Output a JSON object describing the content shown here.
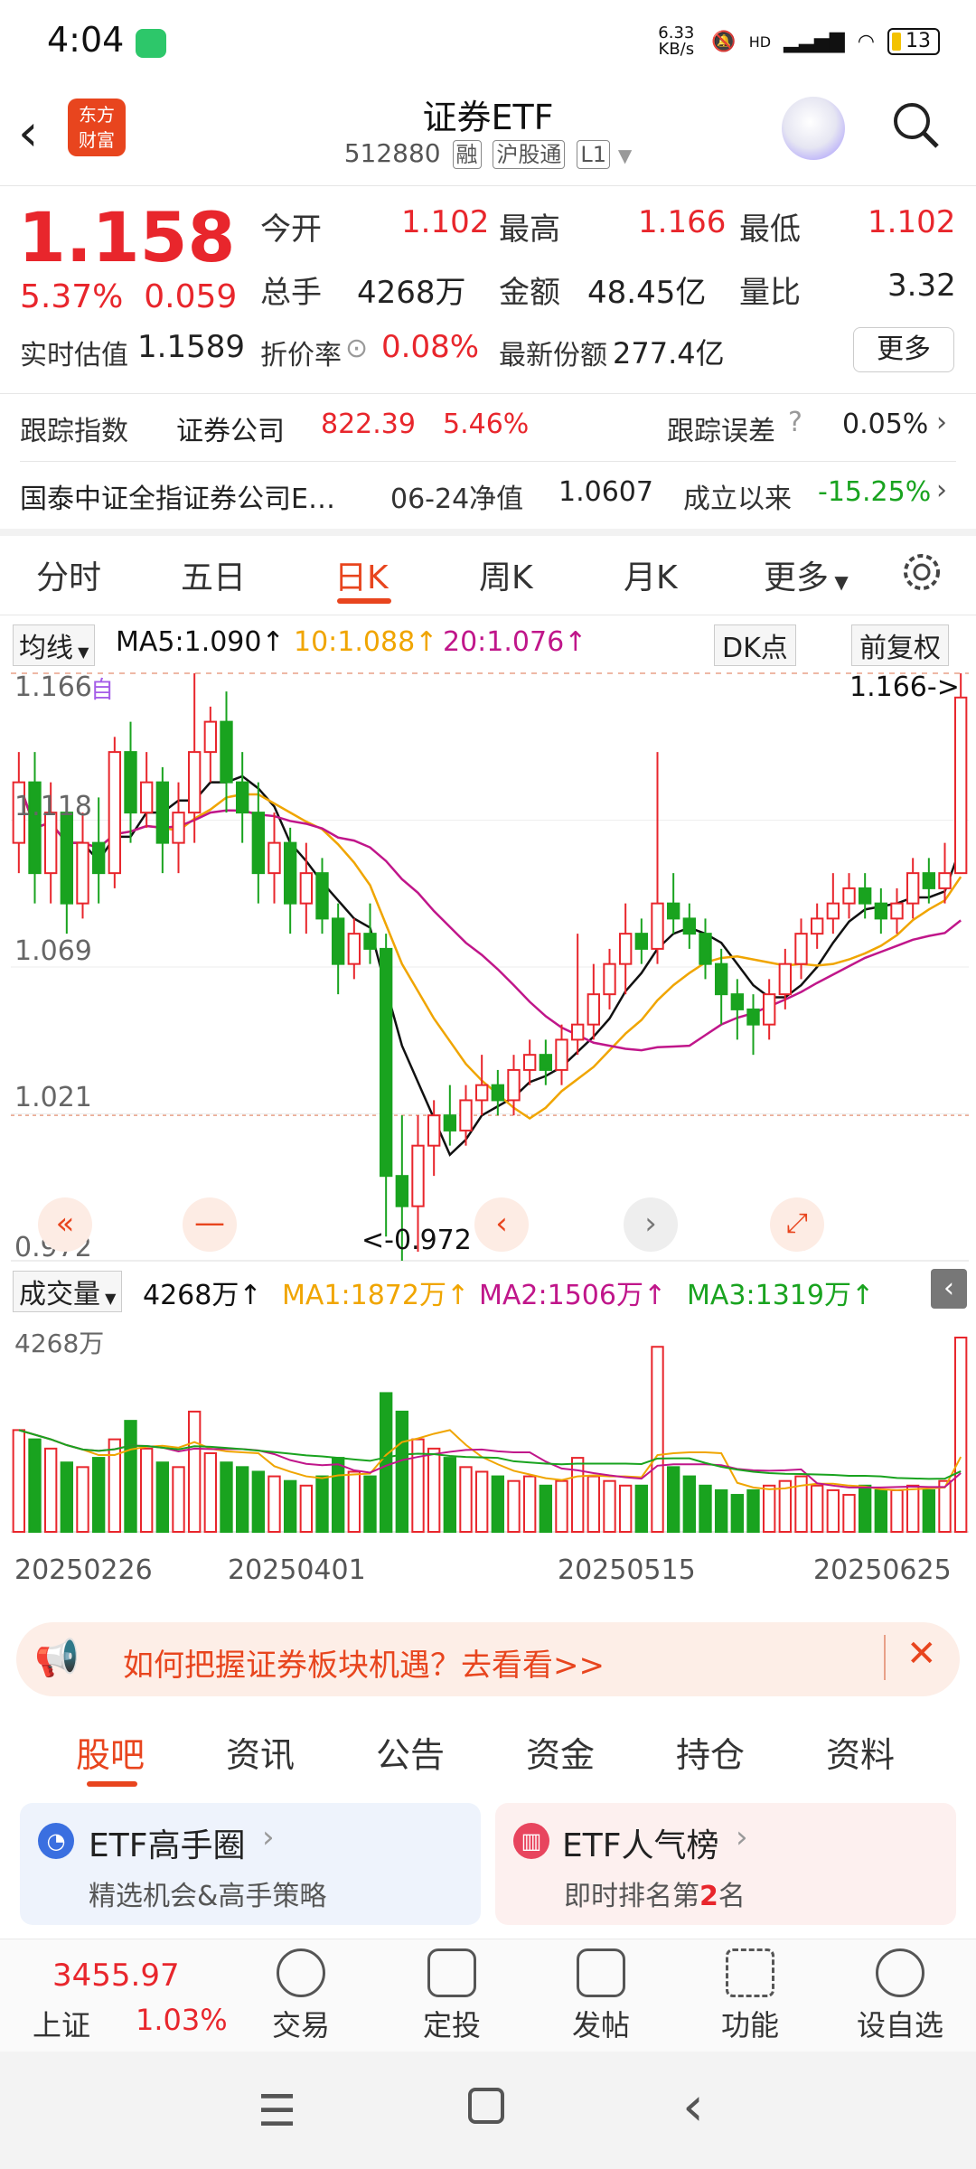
{
  "status_bar": {
    "time": "4:04",
    "net_speed": "6.33 KB/s",
    "signal": "HD",
    "battery": "13"
  },
  "header": {
    "title": "证券ETF",
    "code": "512880",
    "tags": [
      "融",
      "沪股通",
      "L1"
    ],
    "logo_text": "东方财富"
  },
  "quote": {
    "price": "1.158",
    "change_pct": "5.37%",
    "change": "0.059",
    "open_label": "今开",
    "open": "1.102",
    "high_label": "最高",
    "high": "1.166",
    "low_label": "最低",
    "low": "1.102",
    "volume_label": "总手",
    "volume": "4268万",
    "amount_label": "金额",
    "amount": "48.45亿",
    "ratio_label": "量比",
    "ratio": "3.32",
    "iopv_label": "实时估值",
    "iopv": "1.1589",
    "discount_label": "折价率",
    "discount": "0.08%",
    "shares_label": "最新份额",
    "shares": "277.4亿",
    "more": "更多"
  },
  "tracking": {
    "label": "跟踪指数",
    "index": "证券公司",
    "index_value": "822.39",
    "index_pct": "5.46%",
    "error_label": "跟踪误差",
    "error": "0.05%"
  },
  "fund": {
    "name": "国泰中证全指证券公司E…",
    "nav_label": "06-24净值",
    "nav": "1.0607",
    "since_label": "成立以来",
    "since": "-15.25%"
  },
  "period_tabs": [
    "分时",
    "五日",
    "日K",
    "周K",
    "月K",
    "更多"
  ],
  "ma_bar": {
    "selector": "均线",
    "ma5": "MA5:1.090",
    "ma10": "10:1.088",
    "ma20": "20:1.076",
    "dk": "DK点",
    "adjust": "前复权"
  },
  "chart_labels": {
    "y_max": "1.166",
    "y_2": "1.118",
    "y_3": "1.069",
    "y_4": "1.021",
    "y_min": "0.972",
    "high_marker": "1.166->",
    "low_marker": "<-0.972",
    "self_tag": "自"
  },
  "volume_bar": {
    "selector": "成交量",
    "value": "4268万",
    "ma1": "MA1:1872万",
    "ma2": "MA2:1506万",
    "ma3": "MA3:1319万",
    "y_max": "4268万"
  },
  "dates": [
    "20250226",
    "20250401",
    "20250515",
    "20250625"
  ],
  "banner": {
    "text": "如何把握证券板块机遇？去看看>>"
  },
  "sub_tabs": [
    "股吧",
    "资讯",
    "公告",
    "资金",
    "持仓",
    "资料"
  ],
  "cards": [
    {
      "title": "ETF高手圈",
      "desc": "精选机会&高手策略"
    },
    {
      "title": "ETF人气榜",
      "desc_pre": "即时排名第",
      "rank": "2",
      "desc_post": "名"
    }
  ],
  "bottom_nav": {
    "index_value": "3455.97",
    "index_name": "上证",
    "index_pct": "1.03%",
    "items": [
      "交易",
      "定投",
      "发帖",
      "功能",
      "设自选"
    ]
  },
  "chart_data": {
    "type": "candlestick",
    "x": [
      "20250226",
      "20250401",
      "20250515",
      "20250625"
    ],
    "ylim": [
      0.972,
      1.166
    ],
    "price_ticks": [
      "1.166",
      "1.118",
      "1.069",
      "1.021",
      "0.972"
    ],
    "candles": [
      [
        1.11,
        1.13,
        1.1,
        1.14
      ],
      [
        1.13,
        1.1,
        1.09,
        1.14
      ],
      [
        1.1,
        1.12,
        1.09,
        1.13
      ],
      [
        1.12,
        1.09,
        1.08,
        1.125
      ],
      [
        1.09,
        1.11,
        1.085,
        1.12
      ],
      [
        1.11,
        1.1,
        1.09,
        1.125
      ],
      [
        1.1,
        1.14,
        1.095,
        1.145
      ],
      [
        1.14,
        1.12,
        1.11,
        1.15
      ],
      [
        1.12,
        1.13,
        1.115,
        1.14
      ],
      [
        1.13,
        1.11,
        1.1,
        1.135
      ],
      [
        1.11,
        1.12,
        1.1,
        1.13
      ],
      [
        1.12,
        1.14,
        1.11,
        1.166
      ],
      [
        1.14,
        1.15,
        1.13,
        1.155
      ],
      [
        1.15,
        1.13,
        1.12,
        1.16
      ],
      [
        1.13,
        1.12,
        1.11,
        1.14
      ],
      [
        1.12,
        1.1,
        1.09,
        1.13
      ],
      [
        1.1,
        1.11,
        1.09,
        1.12
      ],
      [
        1.11,
        1.09,
        1.08,
        1.115
      ],
      [
        1.09,
        1.1,
        1.08,
        1.11
      ],
      [
        1.1,
        1.085,
        1.08,
        1.105
      ],
      [
        1.085,
        1.07,
        1.06,
        1.09
      ],
      [
        1.07,
        1.08,
        1.065,
        1.085
      ],
      [
        1.08,
        1.075,
        1.07,
        1.09
      ],
      [
        1.075,
        1.0,
        0.98,
        1.08
      ],
      [
        1.0,
        0.99,
        0.972,
        1.02
      ],
      [
        0.99,
        1.01,
        0.975,
        1.02
      ],
      [
        1.01,
        1.02,
        1.0,
        1.025
      ],
      [
        1.02,
        1.015,
        1.01,
        1.03
      ],
      [
        1.015,
        1.025,
        1.01,
        1.03
      ],
      [
        1.025,
        1.03,
        1.02,
        1.04
      ],
      [
        1.03,
        1.025,
        1.02,
        1.035
      ],
      [
        1.025,
        1.035,
        1.02,
        1.04
      ],
      [
        1.035,
        1.04,
        1.03,
        1.045
      ],
      [
        1.04,
        1.035,
        1.03,
        1.045
      ],
      [
        1.035,
        1.045,
        1.03,
        1.05
      ],
      [
        1.045,
        1.05,
        1.04,
        1.08
      ],
      [
        1.05,
        1.06,
        1.045,
        1.07
      ],
      [
        1.06,
        1.07,
        1.055,
        1.075
      ],
      [
        1.07,
        1.08,
        1.06,
        1.09
      ],
      [
        1.08,
        1.075,
        1.07,
        1.085
      ],
      [
        1.075,
        1.09,
        1.07,
        1.14
      ],
      [
        1.09,
        1.085,
        1.08,
        1.1
      ],
      [
        1.085,
        1.08,
        1.075,
        1.09
      ],
      [
        1.08,
        1.07,
        1.065,
        1.085
      ],
      [
        1.07,
        1.06,
        1.05,
        1.075
      ],
      [
        1.06,
        1.055,
        1.045,
        1.065
      ],
      [
        1.055,
        1.05,
        1.04,
        1.06
      ],
      [
        1.05,
        1.06,
        1.045,
        1.065
      ],
      [
        1.06,
        1.07,
        1.055,
        1.075
      ],
      [
        1.07,
        1.08,
        1.065,
        1.085
      ],
      [
        1.08,
        1.085,
        1.075,
        1.09
      ],
      [
        1.085,
        1.09,
        1.08,
        1.1
      ],
      [
        1.09,
        1.095,
        1.085,
        1.1
      ],
      [
        1.095,
        1.09,
        1.085,
        1.1
      ],
      [
        1.09,
        1.085,
        1.08,
        1.095
      ],
      [
        1.085,
        1.09,
        1.08,
        1.095
      ],
      [
        1.09,
        1.1,
        1.085,
        1.105
      ],
      [
        1.1,
        1.095,
        1.09,
        1.105
      ],
      [
        1.095,
        1.1,
        1.09,
        1.11
      ],
      [
        1.1,
        1.158,
        1.102,
        1.166
      ]
    ],
    "volume": [
      22,
      20,
      18,
      15,
      14,
      16,
      20,
      24,
      18,
      15,
      14,
      26,
      17,
      15,
      14,
      13,
      12,
      11,
      10,
      12,
      16,
      13,
      12,
      30,
      26,
      20,
      18,
      16,
      14,
      13,
      12,
      11,
      12,
      10,
      11,
      16,
      12,
      11,
      10,
      10,
      40,
      14,
      12,
      10,
      9,
      8,
      9,
      10,
      11,
      12,
      10,
      9,
      8,
      10,
      9,
      9,
      10,
      9,
      11,
      42
    ],
    "volume_ylim": [
      0,
      4268
    ]
  }
}
